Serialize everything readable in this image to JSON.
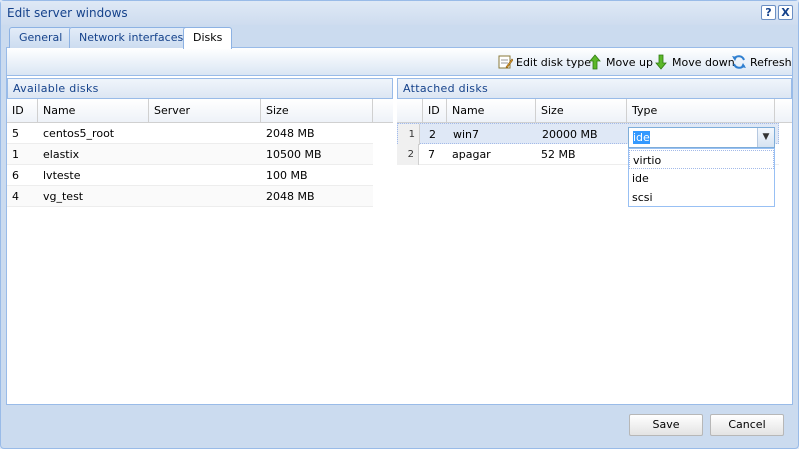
{
  "window": {
    "title": "Edit server windows",
    "help_glyph": "?",
    "close_glyph": "X"
  },
  "tabs": [
    {
      "label": "General"
    },
    {
      "label": "Network interfaces"
    },
    {
      "label": "Disks"
    }
  ],
  "toolbar": {
    "edit_disk_type": "Edit disk type",
    "move_up": "Move up",
    "move_down": "Move down",
    "refresh": "Refresh",
    "icons": {
      "edit": "edit-icon",
      "up": "arrow-up-icon",
      "down": "arrow-down-icon",
      "refresh": "refresh-icon"
    }
  },
  "available": {
    "title": "Available disks",
    "columns": [
      "ID",
      "Name",
      "Server",
      "Size"
    ],
    "rows": [
      {
        "id": "5",
        "name": "centos5_root",
        "server": "",
        "size": "2048 MB"
      },
      {
        "id": "1",
        "name": "elastix",
        "server": "",
        "size": "10500 MB"
      },
      {
        "id": "6",
        "name": "lvteste",
        "server": "",
        "size": "100 MB"
      },
      {
        "id": "4",
        "name": "vg_test",
        "server": "",
        "size": "2048 MB"
      }
    ]
  },
  "attached": {
    "title": "Attached disks",
    "columns": [
      "ID",
      "Name",
      "Size",
      "Type"
    ],
    "rows": [
      {
        "num": "1",
        "id": "2",
        "name": "win7",
        "size": "20000 MB",
        "type": "ide"
      },
      {
        "num": "2",
        "id": "7",
        "name": "apagar",
        "size": "52 MB",
        "type": ""
      }
    ]
  },
  "type_combo": {
    "value": "ide",
    "options": [
      "virtio",
      "ide",
      "scsi"
    ]
  },
  "footer": {
    "save": "Save",
    "cancel": "Cancel"
  },
  "colors": {
    "accent": "#15428b",
    "border": "#99bbe8",
    "selected_row": "#dfe8f6"
  }
}
